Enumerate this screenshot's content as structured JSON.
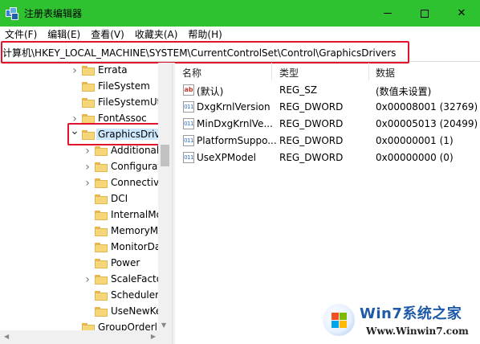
{
  "window": {
    "title": "注册表编辑器",
    "min_glyph": "—",
    "close_glyph": "✕"
  },
  "menu": [
    "文件(F)",
    "编辑(E)",
    "查看(V)",
    "收藏夹(A)",
    "帮助(H)"
  ],
  "address": "计算机\\HKEY_LOCAL_MACHINE\\SYSTEM\\CurrentControlSet\\Control\\GraphicsDrivers",
  "tree": {
    "items": [
      {
        "label": "Errata",
        "expandable": true
      },
      {
        "label": "FileSystem",
        "expandable": false
      },
      {
        "label": "FileSystemUti",
        "expandable": false
      },
      {
        "label": "FontAssoc",
        "expandable": true
      },
      {
        "label": "GraphicsDriv",
        "expandable": true,
        "expanded": true,
        "selected": true
      },
      {
        "label": "Additional",
        "expandable": true
      },
      {
        "label": "Configurat",
        "expandable": true
      },
      {
        "label": "Connectivi",
        "expandable": true
      },
      {
        "label": "DCI",
        "expandable": false
      },
      {
        "label": "InternalMo",
        "expandable": false
      },
      {
        "label": "MemoryM",
        "expandable": false
      },
      {
        "label": "MonitorDa",
        "expandable": false
      },
      {
        "label": "Power",
        "expandable": false
      },
      {
        "label": "ScaleFacto",
        "expandable": true
      },
      {
        "label": "Scheduler",
        "expandable": false
      },
      {
        "label": "UseNewKe",
        "expandable": false
      },
      {
        "label": "GroupOrderl",
        "expandable": false
      }
    ]
  },
  "list": {
    "columns": [
      "名称",
      "类型",
      "数据"
    ],
    "rows": [
      {
        "icon": "string-value-icon",
        "icon_text": "ab",
        "name": "(默认)",
        "type": "REG_SZ",
        "data": "(数值未设置)"
      },
      {
        "icon": "dword-value-icon",
        "icon_text": "011",
        "name": "DxgKrnlVersion",
        "type": "REG_DWORD",
        "data": "0x00008001 (32769)"
      },
      {
        "icon": "dword-value-icon",
        "icon_text": "011",
        "name": "MinDxgKrnlVe...",
        "type": "REG_DWORD",
        "data": "0x00005013 (20499)"
      },
      {
        "icon": "dword-value-icon",
        "icon_text": "011",
        "name": "PlatformSuppo...",
        "type": "REG_DWORD",
        "data": "0x00000001 (1)"
      },
      {
        "icon": "dword-value-icon",
        "icon_text": "011",
        "name": "UseXPModel",
        "type": "REG_DWORD",
        "data": "0x00000000 (0)"
      }
    ]
  },
  "watermark": {
    "title": "Win7系统之家",
    "url": "Www.Winwin7.com"
  },
  "colors": {
    "titlebar": "#2ec230",
    "highlight_border": "#e0142a",
    "selected": "#cce8ff"
  }
}
